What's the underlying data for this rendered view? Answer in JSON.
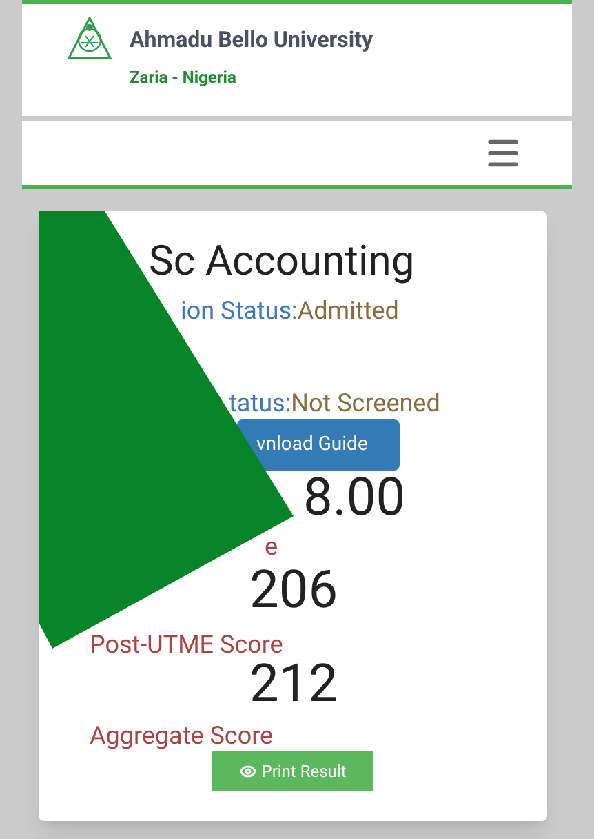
{
  "header": {
    "title": "Ahmadu Bello University",
    "subtitle": "Zaria - Nigeria"
  },
  "result": {
    "programme": "Sc Accounting",
    "admission_status": {
      "label": "ion Status:",
      "value": "Admitted"
    },
    "screening_status": {
      "label": "tatus:",
      "value": "Not Screened"
    },
    "guide_button": "vnload Guide",
    "score_1": "8.00",
    "label_fragment": "e",
    "score_2": "206",
    "post_utme_label": "Post-UTME Score",
    "score_3": "212",
    "aggregate_label": "Aggregate Score",
    "print_button": "Print Result"
  }
}
